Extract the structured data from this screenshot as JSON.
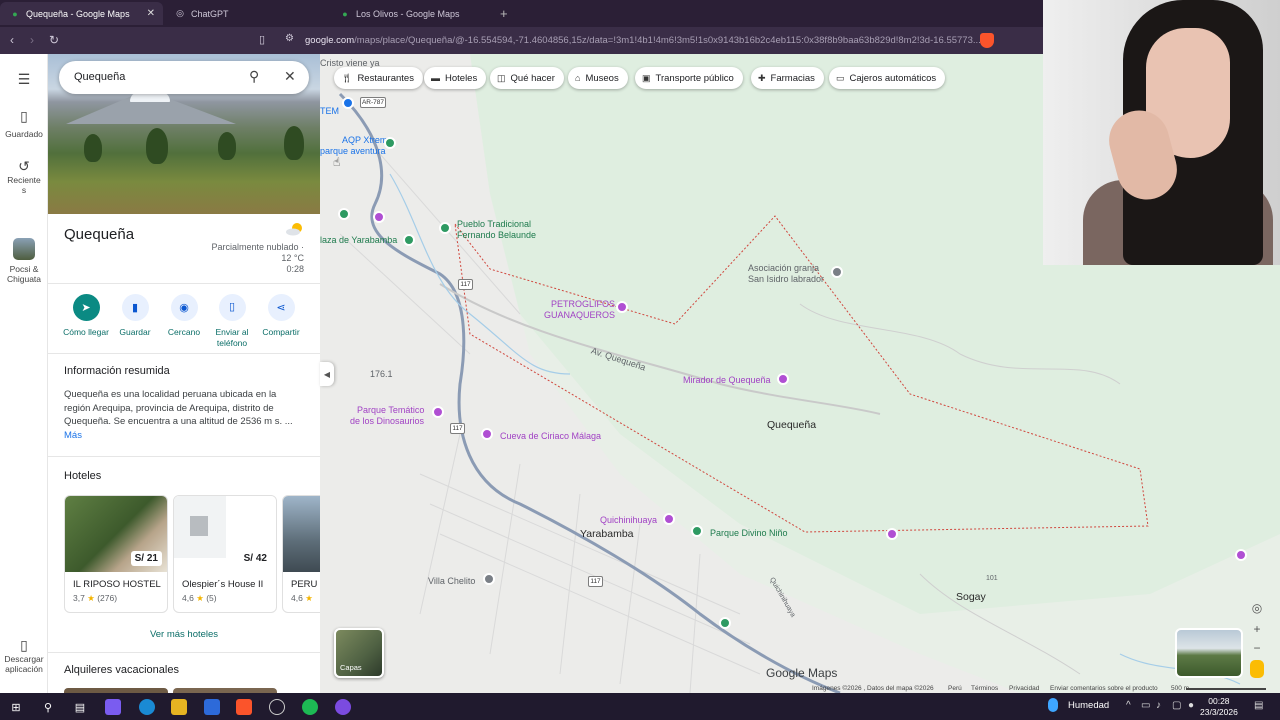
{
  "browser": {
    "tabs": [
      {
        "title": "Quequeña - Google Maps",
        "active": true
      },
      {
        "title": "ChatGPT",
        "active": false
      },
      {
        "title": "Los Olivos - Google Maps",
        "active": false
      }
    ],
    "url_host": "google.com",
    "url_path": "/maps/place/Quequeña/@-16.554594,-71.4604856,15z/data=!3m1!4b1!4m6!3m5!1s0x9143b16b2c4eb115:0x38f8b9baa63b829d!8m2!3d-16.55773..."
  },
  "rail": {
    "saved": "Guardado",
    "recents": "Reciente s",
    "recent_place": "Pocsi & Chiguata",
    "download": "Descargar aplicación"
  },
  "search": {
    "value": "Quequeña"
  },
  "place": {
    "title": "Quequeña",
    "weather_desc": "Parcialmente nublado ·",
    "weather_temp": "12 °C",
    "weather_time": "0:28"
  },
  "actions": [
    {
      "label": "Cómo llegar"
    },
    {
      "label": "Guardar"
    },
    {
      "label": "Cercano"
    },
    {
      "label": "Enviar al teléfono"
    },
    {
      "label": "Compartir"
    }
  ],
  "summary": {
    "heading": "Información resumida",
    "text": "Quequeña es una localidad peruana ubicada en la región Arequipa, provincia de Arequipa, distrito de Quequeña. Se encuentra a una altitud de 2536 m s. ...",
    "more": "Más"
  },
  "hotels": {
    "heading": "Hoteles",
    "items": [
      {
        "name": "IL RIPOSO HOSTEL",
        "price": "S/ 21",
        "rating": "3,7",
        "reviews": "(276)"
      },
      {
        "name": "Olespier´s House II",
        "price": "S/ 42",
        "rating": "4,6",
        "reviews": "(5)"
      },
      {
        "name": "PERU I",
        "price": "",
        "rating": "4,6",
        "reviews": ""
      }
    ],
    "more": "Ver más hoteles"
  },
  "vacation": {
    "heading": "Alquileres vacacionales"
  },
  "map": {
    "chips": [
      "Restaurantes",
      "Hoteles",
      "Qué hacer",
      "Museos",
      "Transporte público",
      "Farmacias",
      "Cajeros automáticos"
    ],
    "labels": {
      "cristo": "Cristo viene ya",
      "aqp": "AQP Xtreme",
      "aqp2": "parque aventura",
      "tem": "TEM",
      "plaza": "laza de Yarabamba",
      "pueblo1": "Pueblo Tradicional",
      "pueblo2": "Fernando Belaunde",
      "granja1": "Asociación granja",
      "granja2": "San Isidro labrador",
      "petro1": "PETROGLIFOS",
      "petro2": "GUANAQUEROS",
      "av": "Av. Quequeña",
      "mirador": "Mirador de Quequeña",
      "quequena": "Quequeña",
      "parque1": "Parque Temático",
      "parque2": "de los Dinosaurios",
      "cueva": "Cueva de Ciriaco Málaga",
      "quichin": "Quichinihuaya",
      "yarabamba": "Yarabamba",
      "divino": "Parque Divino Niño",
      "chelito": "Villa Chelito",
      "sogay": "Sogay",
      "ar787": "AR-787",
      "r117a": "117",
      "r117b": "117",
      "r117c": "117",
      "n1761": "176.1",
      "n101": "101",
      "quichin_road": "Quichinihuaya"
    },
    "layers": "Capas",
    "brand": "Google Maps",
    "footer": {
      "imagery": "Imágenes ©2026 , Datos del mapa ©2026",
      "country": "Perú",
      "terms": "Términos",
      "privacy": "Privacidad",
      "feedback": "Enviar comentarios sobre el producto",
      "scale": "500 m"
    }
  },
  "taskbar": {
    "weather": "Humedad",
    "time": "00:28",
    "date": "23/3/2026"
  },
  "colors": {
    "accent": "#0b8a83",
    "poi_pink": "#b04fd3",
    "poi_green": "#2e9a62",
    "boundary": "#d0463d"
  }
}
